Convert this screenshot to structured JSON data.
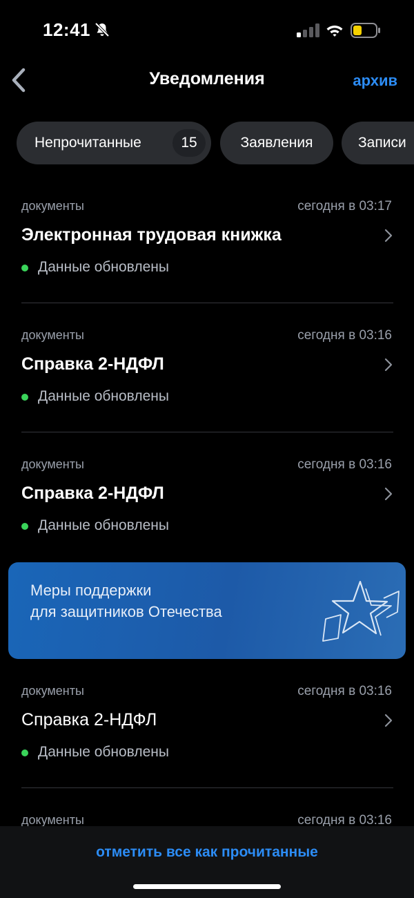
{
  "status_bar": {
    "time": "12:41",
    "icons": [
      "bell-off-icon",
      "signal-icon",
      "wifi-icon",
      "battery-icon"
    ],
    "battery_color": "#f5d100"
  },
  "header": {
    "title": "Уведомления",
    "archive_label": "архив",
    "back_icon": "chevron-left-icon"
  },
  "filters": [
    {
      "label": "Непрочитанные",
      "count": "15",
      "selected": true
    },
    {
      "label": "Заявления"
    },
    {
      "label": "Записи"
    }
  ],
  "notifications": [
    {
      "category": "документы",
      "time": "сегодня в 03:17",
      "title": "Электронная трудовая книжка",
      "status": "Данные обновлены",
      "unread": true
    },
    {
      "category": "документы",
      "time": "сегодня в 03:16",
      "title": "Справка 2-НДФЛ",
      "status": "Данные обновлены",
      "unread": true
    },
    {
      "category": "документы",
      "time": "сегодня в 03:16",
      "title": "Справка 2-НДФЛ",
      "status": "Данные обновлены",
      "unread": true
    },
    {
      "category": "документы",
      "time": "сегодня в 03:16",
      "title": "Справка 2-НДФЛ",
      "status": "Данные обновлены",
      "unread": false
    },
    {
      "category": "документы",
      "time": "сегодня в 03:16"
    }
  ],
  "banner": {
    "line1": "Меры поддержки",
    "line2": "для защитников Отечества",
    "icon": "star-icon"
  },
  "footer": {
    "mark_all_label": "отметить все как прочитанные"
  },
  "colors": {
    "accent": "#2c8cf5",
    "status_dot": "#3ad45a",
    "chip_bg": "#2b2d31",
    "banner_bg": "#1d5aa8"
  }
}
